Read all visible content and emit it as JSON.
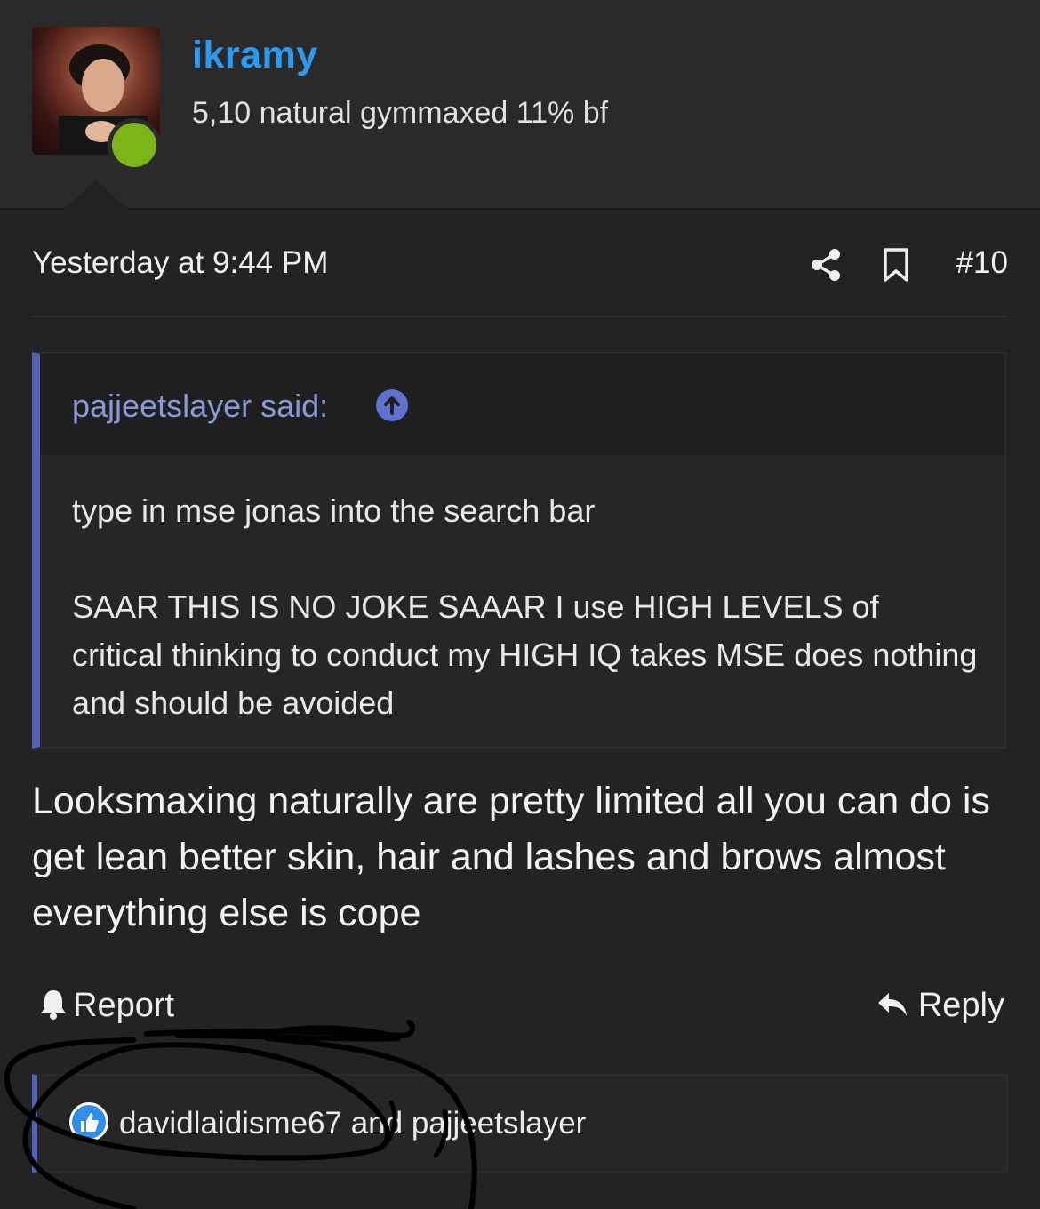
{
  "author": {
    "username": "ikramy",
    "user_title": "5,10 natural gymmaxed 11% bf",
    "online": true,
    "online_color": "#7cb518"
  },
  "post": {
    "timestamp": "Yesterday at 9:44 PM",
    "share_icon": "share-icon",
    "bookmark_icon": "bookmark-icon",
    "post_number": "#10",
    "quote": {
      "author_label": "pajjeetslayer said:",
      "paragraphs": [
        "type in mse jonas into the search bar",
        "SAAR THIS IS NO JOKE SAAAR I use HIGH LEVELS of critical thinking to conduct my HIGH IQ takes MSE does nothing and should be avoided"
      ]
    },
    "body": "Looksmaxing naturally are pretty limited all you can do is get lean better skin, hair and lashes and brows almost everything else is cope"
  },
  "actions": {
    "report_label": "Report",
    "reply_label": "Reply"
  },
  "reactions": {
    "icon": "like-icon",
    "text": "davidlaidisme67 and pajjeetslayer"
  },
  "colors": {
    "username": "#2b9af3",
    "quote_accent": "#5261b8",
    "quote_author": "#8a97d8",
    "background": "#232323"
  }
}
